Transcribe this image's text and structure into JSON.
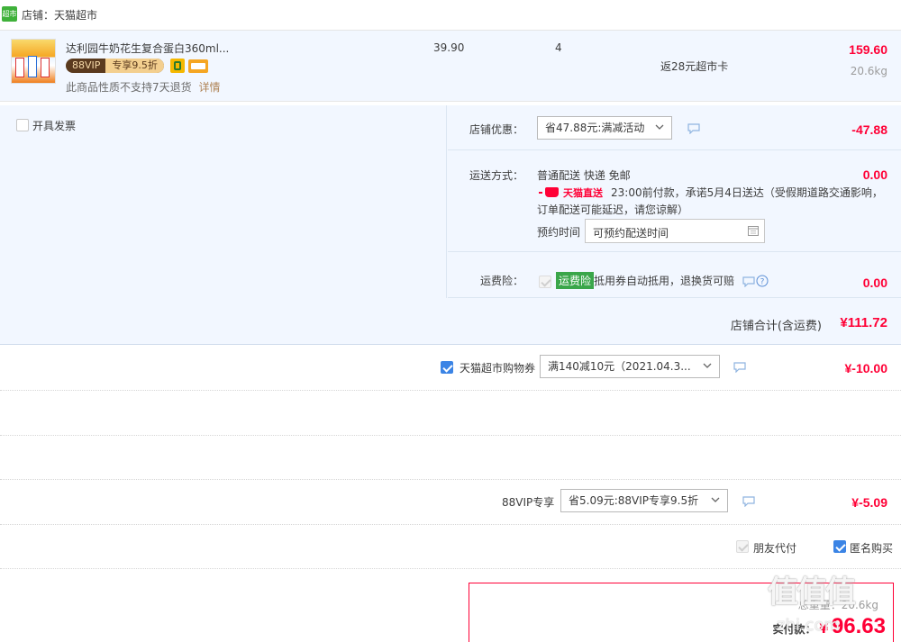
{
  "shop": {
    "label": "店铺：天猫超市",
    "logo_text": "超市"
  },
  "product": {
    "title": "达利园牛奶花生复合蛋白360ml...",
    "vip_badge": "88VIP",
    "vip_discount": "专享9.5折",
    "return_note": "此商品性质不支持7天退货",
    "detail_link": "详情",
    "unit_price": "39.90",
    "quantity": "4",
    "rebate": "返28元超市卡",
    "subtotal": "159.60",
    "weight": "20.6kg"
  },
  "invoice": {
    "label": "开具发票"
  },
  "store_discount": {
    "label": "店铺优惠：",
    "selected": "省47.88元:满减活动",
    "amount": "-47.88"
  },
  "shipping": {
    "label": "运送方式：",
    "method": "普通配送 快递 免邮",
    "amount": "0.00",
    "brand": "天猫直送",
    "promise": "23:00前付款，承诺5月4日送达（受假期道路交通影响，订单配送可能延迟，请您谅解）",
    "appointment_label": "预约时间",
    "appointment_placeholder": "可预约配送时间"
  },
  "insurance": {
    "label": "运费险：",
    "badge": "运费险",
    "desc": "抵用券自动抵用，退换货可赔",
    "amount": "0.00"
  },
  "store_total": {
    "label": "店铺合计(含运费)",
    "amount": "¥111.72"
  },
  "coupon": {
    "label": "天猫超市购物券",
    "selected": "满140减10元（2021.04.3...",
    "amount": "¥-10.00"
  },
  "vip": {
    "label": "88VIP专享",
    "selected": "省5.09元:88VIP专享9.5折",
    "amount": "¥-5.09"
  },
  "options": {
    "friend_pay": "朋友代付",
    "anonymous": "匿名购买"
  },
  "summary": {
    "weight_label": "总重量：",
    "weight": "20.6kg",
    "pay_label": "实付款：",
    "currency": "¥",
    "pay_amount": "96.63"
  },
  "watermark": {
    "logo": "值值值",
    "site": "zhi.com"
  },
  "colors": {
    "accent": "#ff0036",
    "panel_bg": "#f2f7ff",
    "checkbox": "#3b84e5",
    "insurance_green": "#3aa64a",
    "vip_brown": "#8b5a2b"
  }
}
